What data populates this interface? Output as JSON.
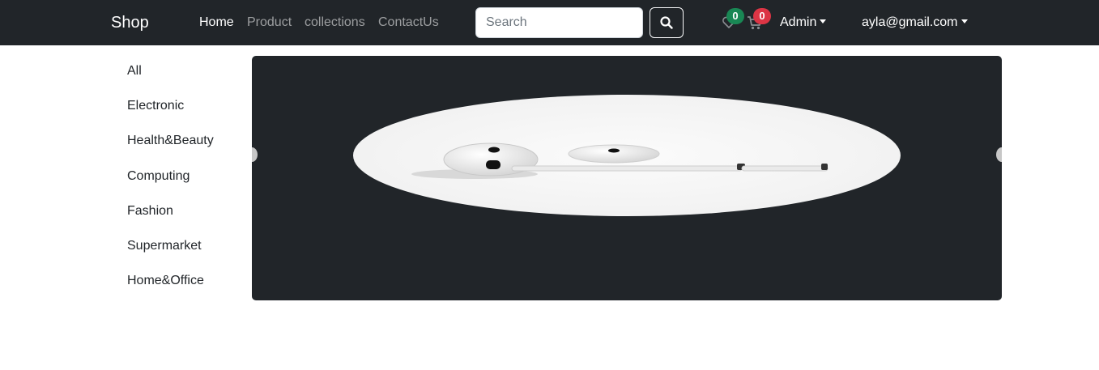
{
  "navbar": {
    "brand": "Shop",
    "links": [
      "Home",
      "Product",
      "collections",
      "ContactUs"
    ],
    "active_link": "Home",
    "search": {
      "placeholder": "Search"
    },
    "wishlist": {
      "count": "0",
      "badge_color": "#198754"
    },
    "cart": {
      "count": "0",
      "badge_color": "#dc3545"
    },
    "admin_menu": "Admin",
    "user_menu": "ayla@gmail.com"
  },
  "sidebar": {
    "categories": [
      "All",
      "Electronic",
      "Health&Beauty",
      "Computing",
      "Fashion",
      "Supermarket",
      "Home&Office"
    ]
  },
  "carousel": {
    "slide_icon": "earbuds-product-image",
    "prev_icon": "carousel-prev-control",
    "next_icon": "carousel-next-control"
  }
}
